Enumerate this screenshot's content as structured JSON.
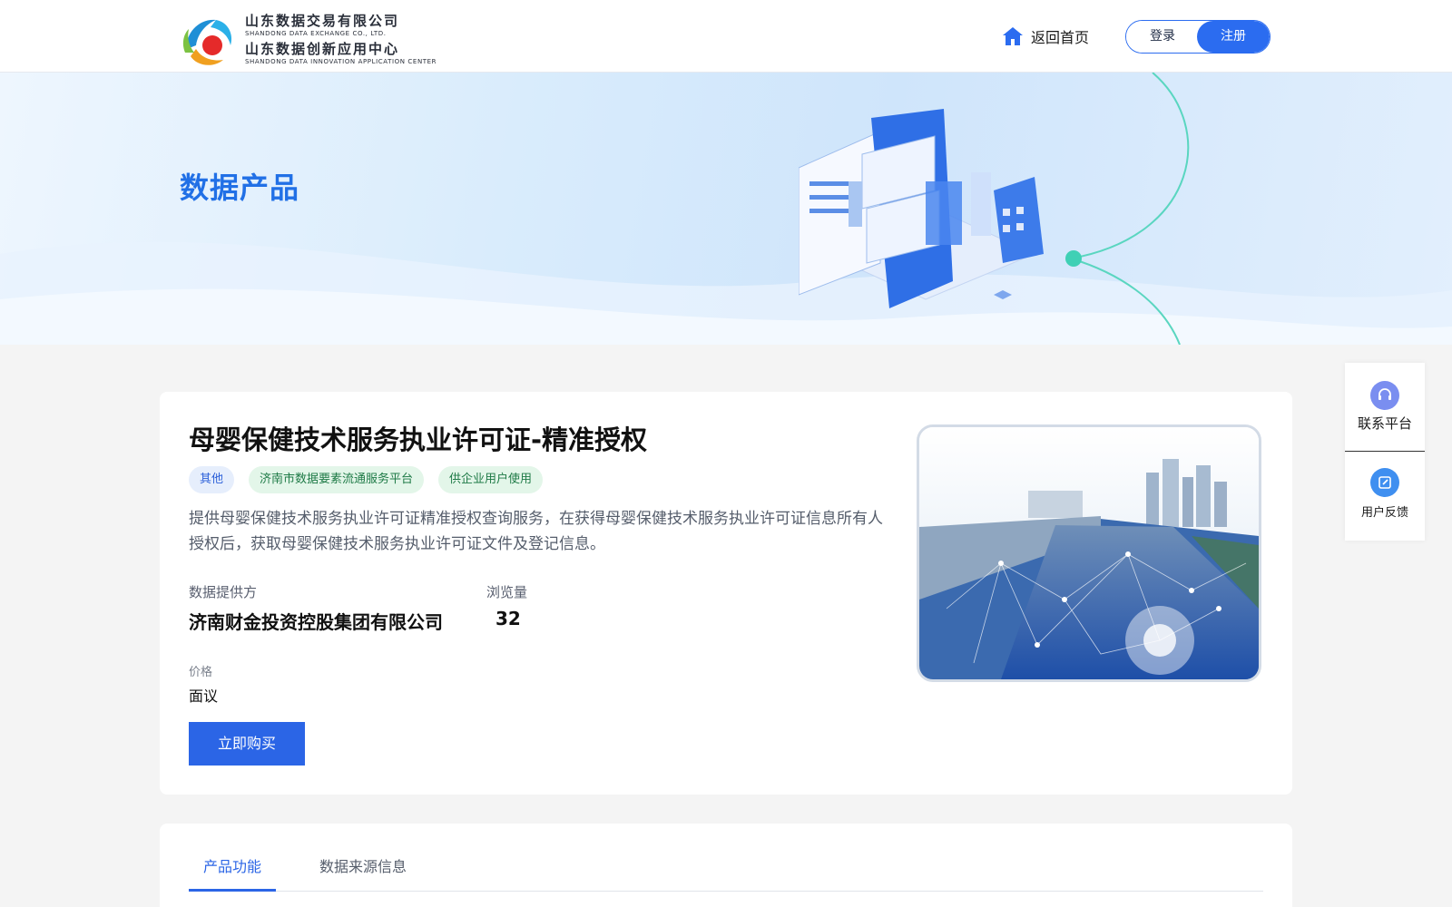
{
  "header": {
    "logo": {
      "company_cn": "山东数据交易有限公司",
      "company_en": "SHANDONG DATA EXCHANGE CO., LTD.",
      "center_cn": "山东数据创新应用中心",
      "center_en": "SHANDONG DATA INNOVATION APPLICATION CENTER"
    },
    "home_label": "返回首页",
    "login_label": "登录",
    "register_label": "注册"
  },
  "banner": {
    "title": "数据产品"
  },
  "product": {
    "title": "母婴保健技术服务执业许可证-精准授权",
    "tags": [
      "其他",
      "济南市数据要素流通服务平台",
      "供企业用户使用"
    ],
    "description": "提供母婴保健技术服务执业许可证精准授权查询服务，在获得母婴保健技术服务执业许可证信息所有人授权后，获取母婴保健技术服务执业许可证文件及登记信息。",
    "provider_label": "数据提供方",
    "provider_value": "济南财金投资控股集团有限公司",
    "views_label": "浏览量",
    "views_value": "32",
    "price_label": "价格",
    "price_value": "面议",
    "buy_label": "立即购买"
  },
  "tabs": [
    {
      "label": "产品功能",
      "active": true
    },
    {
      "label": "数据来源信息",
      "active": false
    }
  ],
  "side_widget": {
    "contact_label": "联系平台",
    "feedback_label": "用户反馈"
  },
  "colors": {
    "primary": "#2b65e6",
    "banner_title": "#2170e6",
    "tag_blue_bg": "#e6eefc",
    "tag_green_bg": "#e3f6e9"
  }
}
